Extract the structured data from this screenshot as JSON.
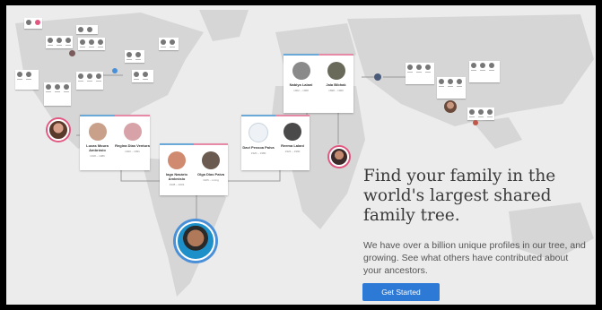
{
  "hero": {
    "headline": "Find your family in the world's largest shared family tree.",
    "description": "We have over a billion unique profiles in our tree, and growing. See what others have contributed about your ancestors.",
    "cta_label": "Get Started"
  },
  "tree": {
    "couple_1": {
      "a": {
        "name": "Lucas Moura Ambrósio",
        "dates": "1918 – 1986"
      },
      "b": {
        "name": "Regina Dias Ventura",
        "dates": "1920 – 1991"
      }
    },
    "couple_2": {
      "a": {
        "name": "Iago Nasário Ambrósio",
        "dates": "1938 – 2003"
      },
      "b": {
        "name": "Olga Dias Paiva",
        "dates": "1945 – Living"
      }
    },
    "couple_3": {
      "a": {
        "name": "Davi Pessoa Paiva",
        "dates": "1920 – 1980"
      },
      "b": {
        "name": "Reema Lalani",
        "dates": "1922 – 1990"
      }
    },
    "couple_4": {
      "a": {
        "name": "Nabiya Lalani",
        "dates": "1902 – 1968"
      },
      "b": {
        "name": "Jaia Bibhak",
        "dates": "1898 – 1960"
      }
    }
  },
  "colors": {
    "male_border": "#6aa8d8",
    "female_border": "#e78aa8",
    "cta": "#2d7ad6",
    "map_land": "#d6d6d6",
    "background": "#ececec"
  }
}
